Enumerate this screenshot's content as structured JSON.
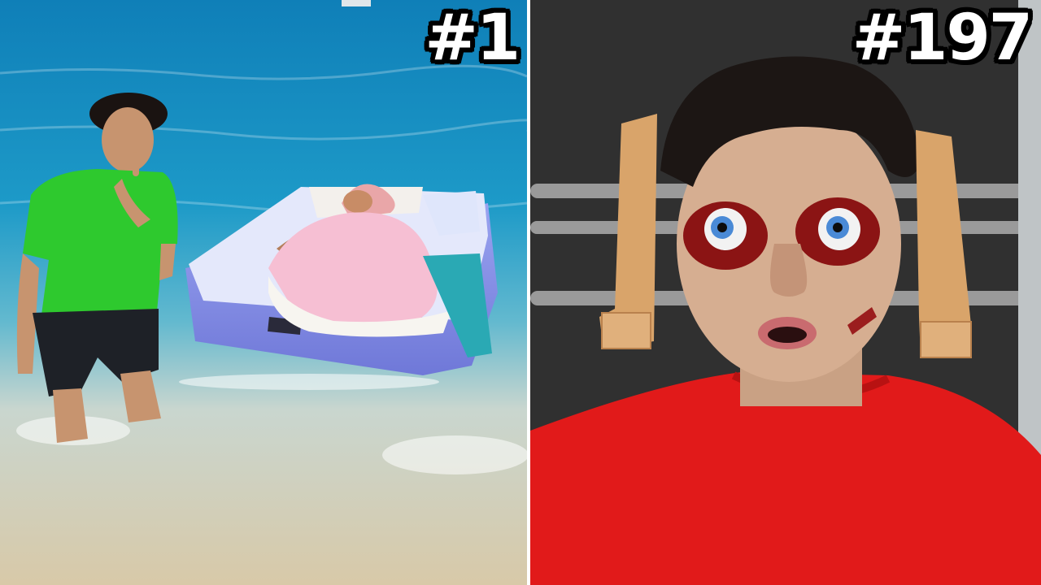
{
  "thumbnail": {
    "left_panel": {
      "rank_label": "#1",
      "colors": {
        "sea_deep": "#1b8fc4",
        "sea_shallow": "#d9cdb0",
        "shirt": "#2ec92e",
        "mattress": "#8f97e8",
        "blanket": "#f6bfd3"
      }
    },
    "right_panel": {
      "rank_label": "#197",
      "colors": {
        "background": "#2b2b2b",
        "shirt": "#e11a1a",
        "wood": "#d9a46a",
        "metal_rod": "#9a9a9a"
      }
    }
  }
}
